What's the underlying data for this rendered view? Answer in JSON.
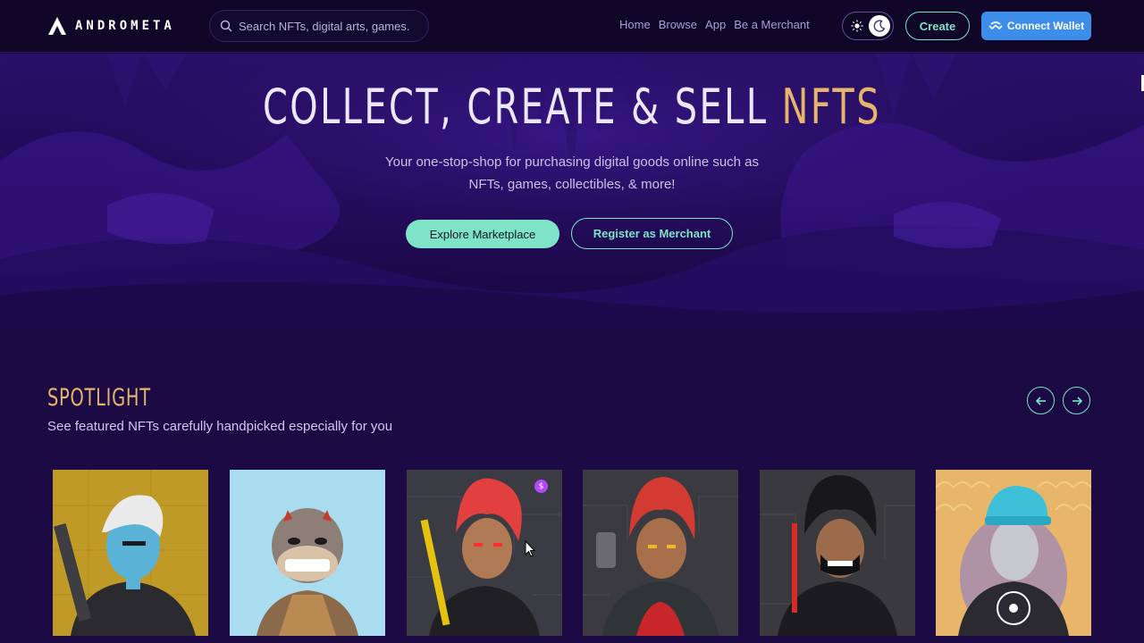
{
  "navbar": {
    "brand": "ANDROMETA",
    "search": {
      "placeholder": "Search NFTs, digital arts, games."
    },
    "links": [
      "Home",
      "Browse",
      "App",
      "Be a Merchant"
    ],
    "theme": {
      "light_icon": "sun-icon",
      "dark_icon": "moon-icon",
      "active": "dark"
    },
    "create_label": "Create",
    "wallet_label": "Connect Wallet"
  },
  "hero": {
    "title_main": "COLLECT, CREATE & SELL ",
    "title_accent": "NFTS",
    "subtitle_line1": "Your one-stop-shop for purchasing digital goods online such as",
    "subtitle_line2": "NFTs, games, collectibles, & more!",
    "explore_label": "Explore Marketplace",
    "register_label": "Register as Merchant"
  },
  "spotlight": {
    "title": "SPOTLIGHT",
    "subtitle": "See featured NFTs carefully handpicked especially for you",
    "prev_icon": "arrow-left-icon",
    "next_icon": "arrow-right-icon",
    "cards": [
      {
        "bg": "#c09a26"
      },
      {
        "bg": "#a9dcef"
      },
      {
        "bg": "#3b3b44",
        "badge": "$"
      },
      {
        "bg": "#3a3a40"
      },
      {
        "bg": "#3a3a3e"
      },
      {
        "bg": "#e7b66a"
      }
    ]
  },
  "colors": {
    "accent_mint": "#7fe3c7",
    "accent_gold": "#e6b46b",
    "wallet_blue": "#3d8eea",
    "background": "#1c0a45"
  }
}
